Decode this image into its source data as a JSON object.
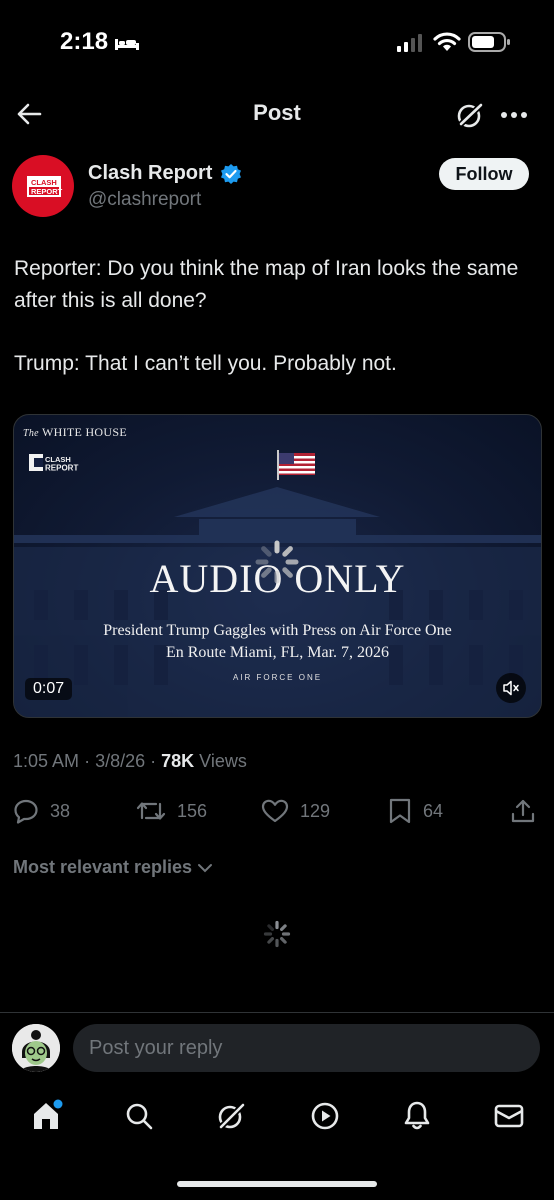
{
  "status_bar": {
    "time": "2:18"
  },
  "header": {
    "title": "Post"
  },
  "author": {
    "name": "Clash Report",
    "handle": "@clashreport",
    "avatar_text": [
      "CLASH",
      "REPORT"
    ],
    "verified": true,
    "follow_label": "Follow"
  },
  "post": {
    "paragraphs": [
      "Reporter: Do you think the map of Iran looks the same after this is all done?",
      "Trump: That I can’t tell you. Probably not."
    ]
  },
  "media": {
    "source_prefix": "The",
    "source": "WHITE HOUSE",
    "overlay_logo": [
      "CLASH",
      "REPORT"
    ],
    "headline": "AUDIO ONLY",
    "subtitle_line1": "President Trump Gaggles with Press on Air Force One",
    "subtitle_line2": "En Route Miami, FL, Mar. 7, 2026",
    "tagline": "AIR FORCE ONE",
    "duration": "0:07"
  },
  "meta": {
    "time": "1:05 AM",
    "date": "3/8/26",
    "views_count": "78K",
    "views_label": "Views"
  },
  "actions": {
    "replies": "38",
    "reposts": "156",
    "likes": "129",
    "bookmarks": "64"
  },
  "replies_filter": {
    "label": "Most relevant replies"
  },
  "reply_input": {
    "placeholder": "Post your reply"
  },
  "colors": {
    "background": "#000000",
    "text": "#e7e9ea",
    "secondary": "#71767b",
    "verified": "#1d9bf0",
    "avatar": "#d90e24",
    "notification_dot": "#1d9bf0"
  },
  "icons": [
    "back-arrow-icon",
    "grok-icon",
    "more-icon",
    "verified-badge-icon",
    "mute-icon",
    "reply-icon",
    "repost-icon",
    "like-icon",
    "bookmark-icon",
    "share-icon",
    "chevron-down-icon",
    "loading-spinner-icon",
    "home-icon",
    "search-icon",
    "grok-icon",
    "video-icon",
    "notifications-icon",
    "messages-icon"
  ]
}
